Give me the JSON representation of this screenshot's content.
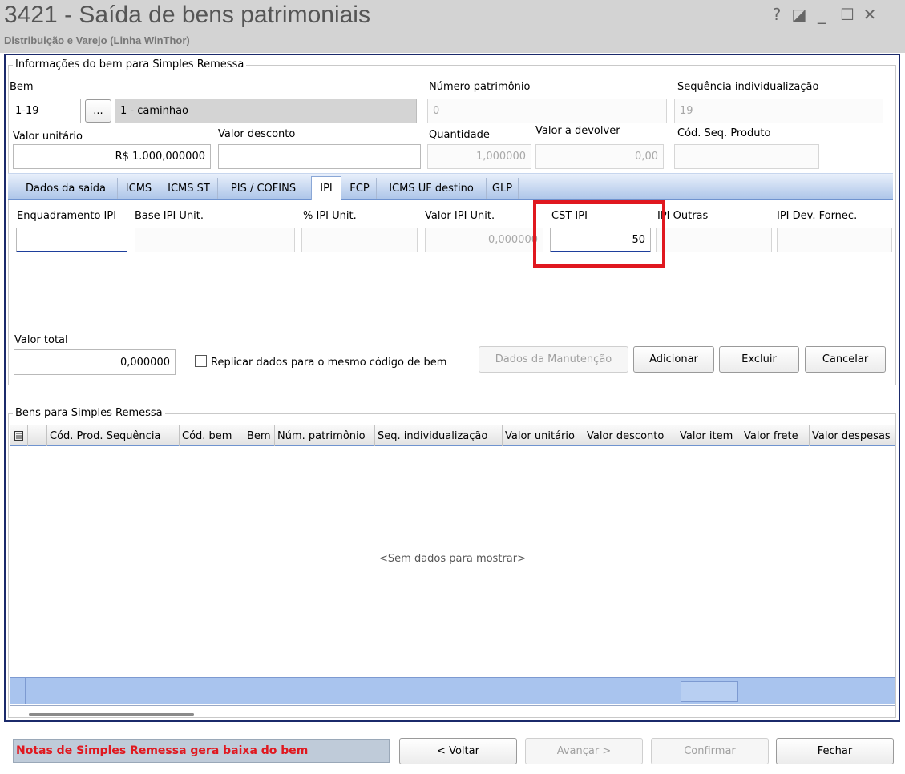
{
  "window": {
    "title": "3421 - Saída de bens patrimoniais",
    "subtitle": "Distribuição e Varejo (Linha WinThor)",
    "help": "?",
    "restore": "◪",
    "minimize": "_",
    "maximize": "☐",
    "close": "✕"
  },
  "info": {
    "legend": "Informações do bem para Simples Remessa",
    "bem_label": "Bem",
    "bem_code": "1-19",
    "bem_lookup": "...",
    "bem_desc": "1 - caminhao",
    "num_patrimonio_label": "Número patrimônio",
    "num_patrimonio": "0",
    "seq_indiv_label": "Sequência individualização",
    "seq_indiv": "19",
    "valor_unitario_label": "Valor unitário",
    "valor_unitario": "R$ 1.000,000000",
    "valor_desconto_label": "Valor desconto",
    "valor_desconto": "",
    "quantidade_label": "Quantidade",
    "quantidade": "1,000000",
    "valor_devolver_label": "Valor a devolver",
    "valor_devolver": "0,00",
    "cod_seq_label": "Cód. Seq. Produto",
    "cod_seq": ""
  },
  "tabs": [
    "Dados da saída",
    "ICMS",
    "ICMS ST",
    "PIS / COFINS",
    "IPI",
    "FCP",
    "ICMS UF destino",
    "GLP"
  ],
  "ipi": {
    "enquadramento_label": "Enquadramento IPI",
    "base_label": "Base IPI Unit.",
    "perc_label": "% IPI Unit.",
    "valor_label": "Valor IPI Unit.",
    "valor": "0,000000",
    "cst_label": "CST IPI",
    "cst": "50",
    "outras_label": "IPI Outras",
    "dev_label": "IPI Dev. Fornec.",
    "highlight_color": "#e0181f"
  },
  "actions": {
    "valor_total_label": "Valor total",
    "valor_total": "0,000000",
    "replicar_label": "Replicar dados para o mesmo código de bem",
    "manutencao": "Dados da Manutenção",
    "adicionar": "Adicionar",
    "excluir": "Excluir",
    "cancelar": "Cancelar"
  },
  "grid": {
    "legend": "Bens para Simples Remessa",
    "columns": [
      "Cód. Prod. Sequência",
      "Cód. bem",
      "Bem",
      "Núm. patrimônio",
      "Seq. individualização",
      "Valor unitário",
      "Valor desconto",
      "Valor item",
      "Valor frete",
      "Valor despesas"
    ],
    "empty": "<Sem dados para mostrar>"
  },
  "footer": {
    "warning": "Notas de Simples Remessa gera baixa do bem",
    "warning_color": "#e0181f",
    "voltar": "< Voltar",
    "avancar": "Avançar >",
    "confirmar": "Confirmar",
    "fechar": "Fechar"
  }
}
